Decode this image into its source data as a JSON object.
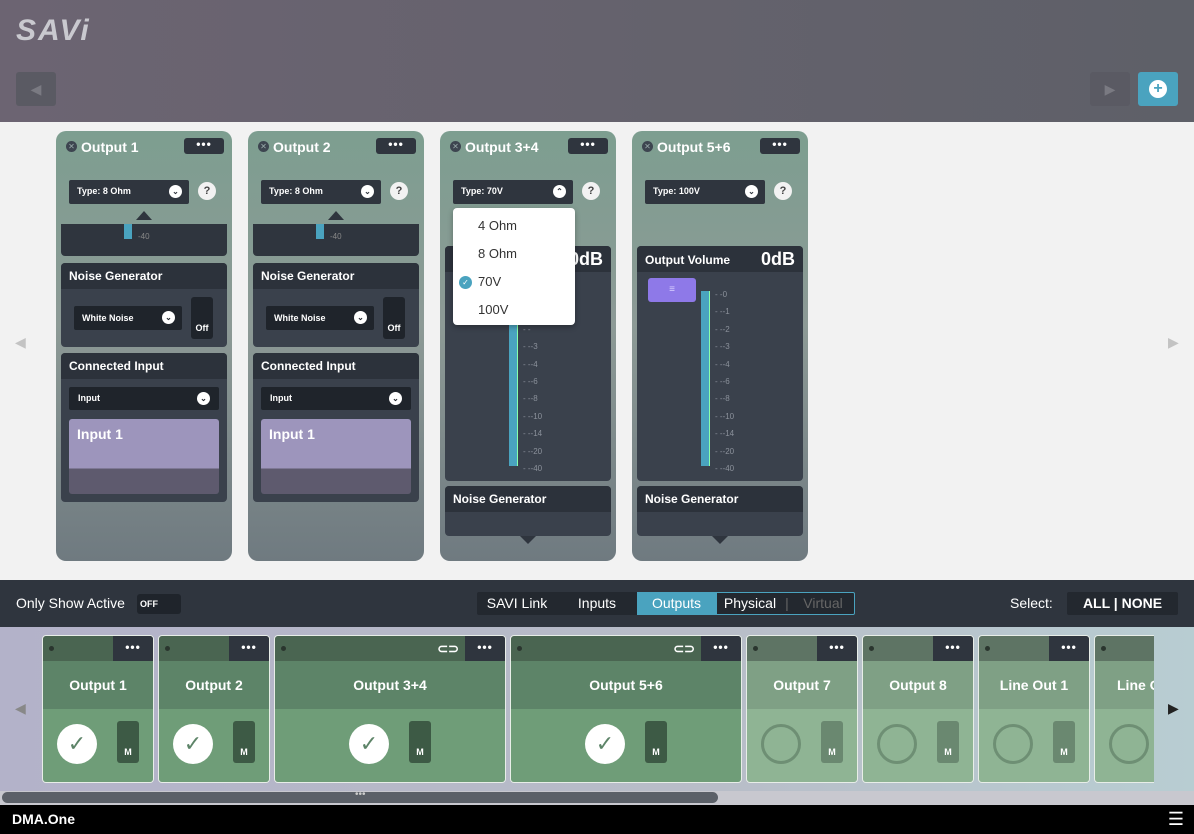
{
  "app": {
    "logo": "SAVi",
    "footer_title": "DMA.One"
  },
  "header": {
    "back_icon": "chevron-left-icon",
    "forward_icon": "chevron-right-icon",
    "add_icon": "plus-icon"
  },
  "cards": [
    {
      "title": "Output 1",
      "type": "Type: 8 Ohm",
      "meter_label": "-40",
      "noise_title": "Noise Generator",
      "noise_type": "White Noise",
      "noise_state": "Off",
      "input_title": "Connected Input",
      "input_select": "Input",
      "input_name": "Input 1"
    },
    {
      "title": "Output 2",
      "type": "Type: 8 Ohm",
      "meter_label": "-40",
      "noise_title": "Noise Generator",
      "noise_type": "White Noise",
      "noise_state": "Off",
      "input_title": "Connected Input",
      "input_select": "Input",
      "input_name": "Input 1"
    },
    {
      "title": "Output 3+4",
      "type": "Type: 70V",
      "volume_db": "0dB",
      "noise_title": "Noise Generator"
    },
    {
      "title": "Output 5+6",
      "type": "Type: 100V",
      "volume_title": "Output Volume",
      "volume_db": "0dB",
      "noise_title": "Noise Generator"
    }
  ],
  "ticks": [
    "0",
    "-1",
    "-2",
    "-3",
    "-4",
    "-6",
    "-8",
    "-10",
    "-14",
    "-20",
    "-40"
  ],
  "dropdown": {
    "options": [
      "4 Ohm",
      "8 Ohm",
      "70V",
      "100V"
    ],
    "selected": "70V"
  },
  "filterbar": {
    "only_active_label": "Only Show Active",
    "only_active_state": "OFF",
    "tabs": [
      "SAVI Link",
      "Inputs",
      "Outputs",
      "Physical",
      "Virtual"
    ],
    "active_tab": "Outputs",
    "select_label": "Select:",
    "all_label": "ALL",
    "sep": "|",
    "none_label": "NONE"
  },
  "channels": [
    {
      "name": "Output 1",
      "active": true,
      "linked": false,
      "mute": "M"
    },
    {
      "name": "Output 2",
      "active": true,
      "linked": false,
      "mute": "M"
    },
    {
      "name": "Output 3+4",
      "active": true,
      "linked": true,
      "mute": "M"
    },
    {
      "name": "Output 5+6",
      "active": true,
      "linked": true,
      "mute": "M"
    },
    {
      "name": "Output 7",
      "active": false,
      "linked": false,
      "mute": "M"
    },
    {
      "name": "Output 8",
      "active": false,
      "linked": false,
      "mute": "M"
    },
    {
      "name": "Line Out 1",
      "active": false,
      "linked": false,
      "mute": "M"
    },
    {
      "name": "Line O",
      "active": false,
      "linked": false,
      "mute": "M"
    }
  ],
  "colors": {
    "accent": "#4aa3bf",
    "handle": "#8e79e8",
    "channel_on": "#6f9d78",
    "channel_off": "#8fb494"
  }
}
